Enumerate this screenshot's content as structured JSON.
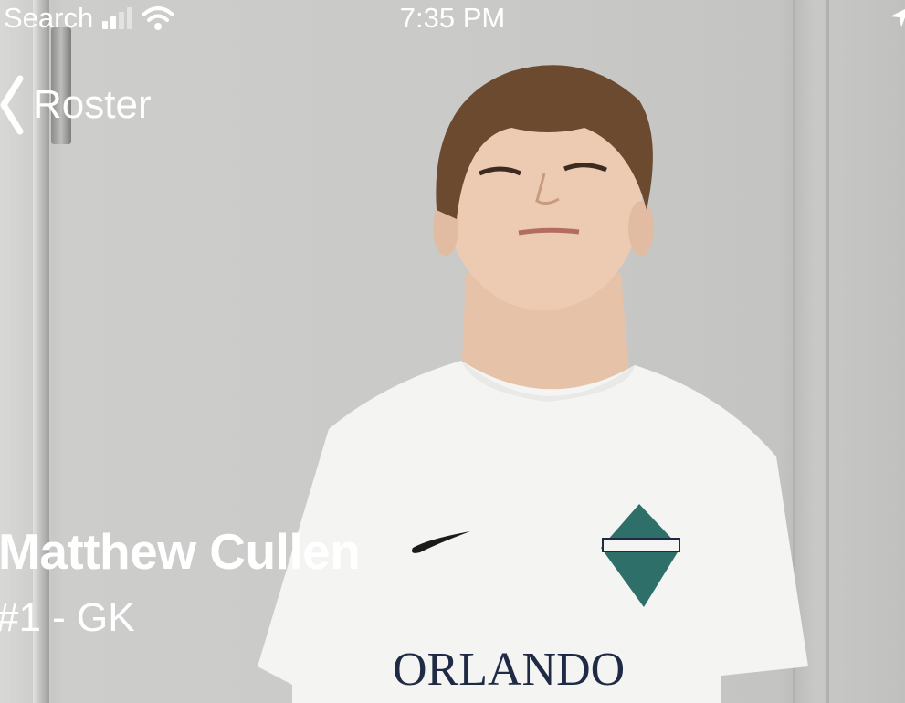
{
  "status_bar": {
    "back_app_label": "Search",
    "time": "7:35 PM",
    "signal_bars_active": 2,
    "signal_bars_total": 4,
    "icons": [
      "cellular-signal-icon",
      "wifi-icon",
      "location-arrow-icon"
    ]
  },
  "nav": {
    "back_label": "Roster",
    "back_icon": "chevron-left-icon"
  },
  "player": {
    "name": "Matthew Cullen",
    "number_position": "#1 - GK",
    "jersey_text": "ORLANDO"
  },
  "colors": {
    "overlay_text": "#ffffff",
    "wall": "#c9c9c7",
    "jersey": "#f4f4f2",
    "jersey_print": "#1f2a44"
  }
}
